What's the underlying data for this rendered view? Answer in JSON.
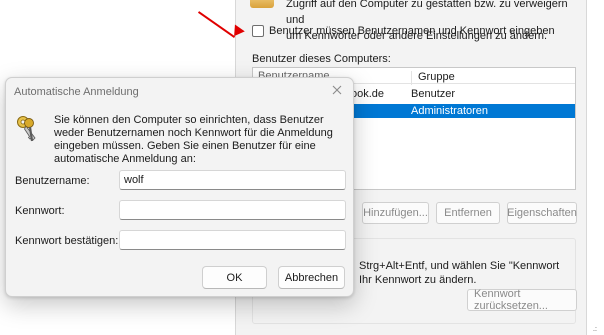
{
  "background_window": {
    "intro_line1": "Zugriff auf den Computer zu gestatten bzw. zu verweigern und",
    "intro_line2": "um Kennwörter oder andere Einstellungen zu ändern.",
    "must_enter_label": "Benutzer müssen Benutzernamen und Kennwort eingeben",
    "must_enter_checked": false,
    "users_label": "Benutzer dieses Computers:",
    "columns": {
      "user": "Benutzername",
      "group": "Gruppe"
    },
    "rows": [
      {
        "user": "ook.de",
        "group": "Benutzer",
        "selected": false
      },
      {
        "user": "",
        "group": "Administratoren",
        "selected": true
      }
    ],
    "add_button": "Hinzufügen...",
    "remove_button": "Entfernen",
    "properties_button": "Eigenschaften",
    "password_text_line1": "Strg+Alt+Entf, und wählen Sie \"Kennwort",
    "password_text_line2": "Ihr Kennwort zu ändern.",
    "reset_password_button": "Kennwort zurücksetzen...",
    "corner_mark": ".:"
  },
  "dialog": {
    "title": "Automatische Anmeldung",
    "description": "Sie können den Computer so einrichten, dass Benutzer weder Benutzernamen noch Kennwort für die Anmeldung eingeben müssen. Geben Sie einen Benutzer für eine automatische Anmeldung an:",
    "username_label": "Benutzername:",
    "username_value": "wolf",
    "password_label": "Kennwort:",
    "password_value": "",
    "confirm_label": "Kennwort bestätigen:",
    "confirm_value": "",
    "ok_button": "OK",
    "cancel_button": "Abbrechen"
  },
  "colors": {
    "selection": "#0078d4",
    "annotation_arrow": "#e00000"
  }
}
